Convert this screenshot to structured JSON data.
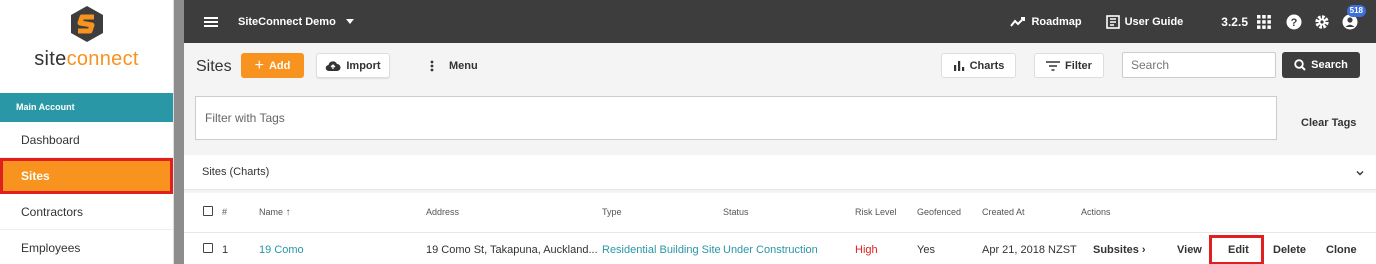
{
  "brand": {
    "name_prefix": "site",
    "name_suffix": "connect",
    "accent": "#f7931e",
    "teal": "#2a97a7",
    "alert": "#e02020"
  },
  "sidebar": {
    "account_label": "Main Account",
    "items": [
      {
        "label": "Dashboard",
        "active": false
      },
      {
        "label": "Sites",
        "active": true
      },
      {
        "label": "Contractors",
        "active": false
      },
      {
        "label": "Employees",
        "active": false
      }
    ]
  },
  "topbar": {
    "project": "SiteConnect Demo",
    "roadmap": "Roadmap",
    "user_guide": "User Guide",
    "version": "3.2.5",
    "notification_count": "518",
    "icons": [
      "menu-icon",
      "trend-icon",
      "book-icon",
      "grid-icon",
      "help-icon",
      "gear-icon",
      "user-icon"
    ]
  },
  "header": {
    "title": "Sites",
    "add_label": "Add",
    "import_label": "Import",
    "menu_label": "Menu",
    "charts_label": "Charts",
    "filter_label": "Filter",
    "search_placeholder": "Search",
    "search_label": "Search"
  },
  "tags": {
    "placeholder": "Filter with Tags",
    "clear_label": "Clear Tags"
  },
  "charts_panel": {
    "label": "Sites (Charts)"
  },
  "table": {
    "columns": [
      "#",
      "Name",
      "Address",
      "Type",
      "Status",
      "Risk Level",
      "Geofenced",
      "Created At",
      "Actions"
    ],
    "rows": [
      {
        "index": "1",
        "name": "19 Como",
        "address": "19 Como St, Takapuna, Auckland...",
        "type": "Residential Building Site",
        "status": "Under Construction",
        "risk": "High",
        "geofenced": "Yes",
        "created": "Apr 21, 2018 NZST",
        "actions": {
          "subsites": "Subsites",
          "view": "View",
          "edit": "Edit",
          "delete": "Delete",
          "clone": "Clone"
        }
      }
    ]
  }
}
